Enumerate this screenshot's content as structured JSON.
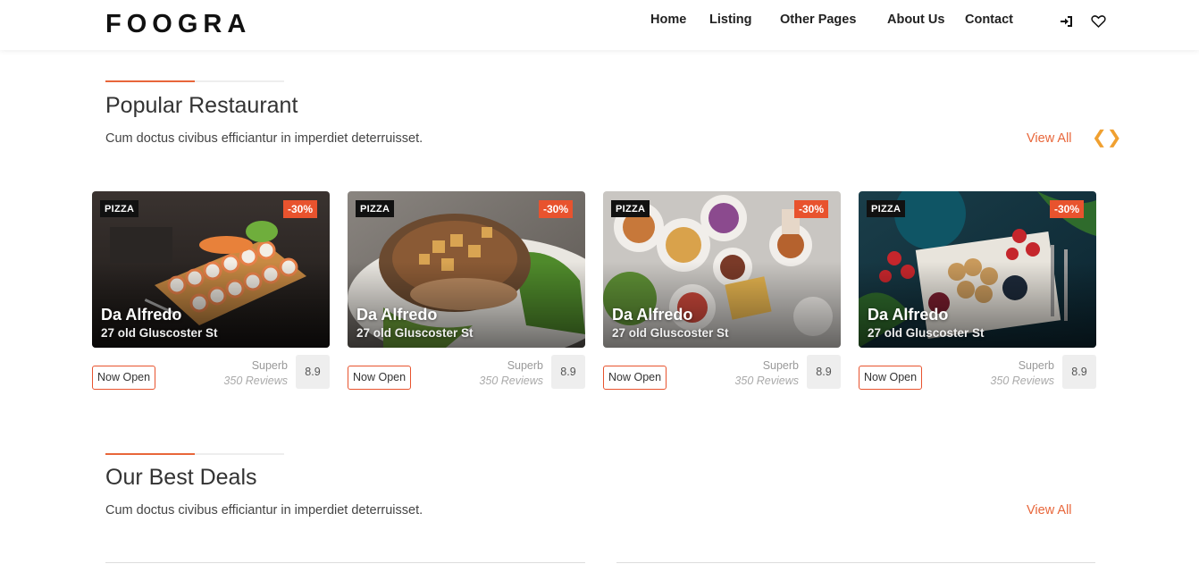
{
  "header": {
    "logo": "FOOGRA",
    "nav": [
      {
        "label": "Home"
      },
      {
        "label": "Listing"
      },
      {
        "label": "Other Pages"
      },
      {
        "label": "About Us"
      },
      {
        "label": "Contact"
      }
    ],
    "icons": [
      "login-icon",
      "heart-icon"
    ]
  },
  "popular": {
    "title": "Popular Restaurant",
    "subtitle": "Cum doctus civibus efficiantur in imperdiet deterruisset.",
    "view_all": "View All",
    "arrows": {
      "prev": "❮",
      "next": "❯"
    },
    "cards": [
      {
        "tag": "PIZZA",
        "discount": "-30%",
        "name": "Da Alfredo",
        "address": "27 old Gluscoster St",
        "status": "Now Open",
        "rating_label": "Superb",
        "reviews": "350 Reviews",
        "score": "8.9"
      },
      {
        "tag": "PIZZA",
        "discount": "-30%",
        "name": "Da Alfredo",
        "address": "27 old Gluscoster St",
        "status": "Now Open",
        "rating_label": "Superb",
        "reviews": "350 Reviews",
        "score": "8.9"
      },
      {
        "tag": "PIZZA",
        "discount": "-30%",
        "name": "Da Alfredo",
        "address": "27 old Gluscoster St",
        "status": "Now Open",
        "rating_label": "Superb",
        "reviews": "350 Reviews",
        "score": "8.9"
      },
      {
        "tag": "PIZZA",
        "discount": "-30%",
        "name": "Da Alfredo",
        "address": "27 old Gluscoster St",
        "status": "Now Open",
        "rating_label": "Superb",
        "reviews": "350 Reviews",
        "score": "8.9"
      }
    ]
  },
  "deals": {
    "title": "Our Best Deals",
    "subtitle": "Cum doctus civibus efficiantur in imperdiet deterruisset.",
    "view_all": "View All"
  },
  "colors": {
    "accent": "#e8663a",
    "discount": "#e8532e",
    "arrow": "#f0a030"
  }
}
